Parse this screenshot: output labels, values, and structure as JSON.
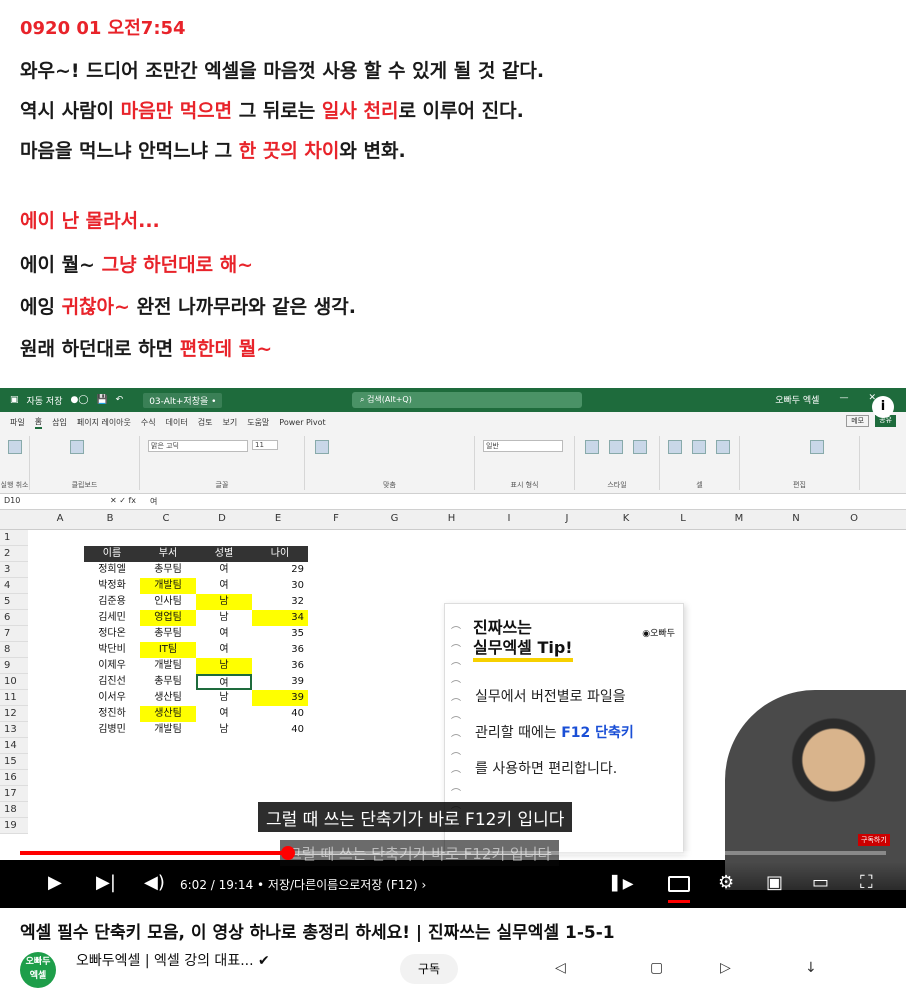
{
  "blog": {
    "timestamp": "0920 01 오전7:54",
    "l1": "와우~! 드디어 조만간 엑셀을 마음껏 사용 할 수 있게 될 것 같다.",
    "l2a": "역시 사람이 ",
    "l2b": "마음만 먹으면",
    "l2c": " 그 뒤로는 ",
    "l2d": "일사 천리",
    "l2e": "로 이루어 진다.",
    "l3a": "마음을 먹느냐 안먹느냐 그 ",
    "l3b": "한 끗의 차이",
    "l3c": "와 변화.",
    "l4": "에이 난 몰라서...",
    "l5a": "에이 뭘~ ",
    "l5b": "그냥 하던대로 해~",
    "l6a": "에잉 ",
    "l6b": "귀찮아~",
    "l6c": " 완전 나까무라와 같은 생각.",
    "l7a": "원래 하던대로 하면 ",
    "l7b": "편한데 뭘~"
  },
  "excel": {
    "autosave": "자동 저장",
    "filename": "03-Alt+저창을 •",
    "search": "검색(Alt+Q)",
    "user": "오빠두 엑셀",
    "menu": [
      "파일",
      "홈",
      "삽입",
      "페이지 레이아웃",
      "수식",
      "데이터",
      "검토",
      "보기",
      "도움말",
      "Power Pivot"
    ],
    "memo": "메모",
    "share": "공유",
    "ribbon_groups": [
      "실행 취소",
      "클립보드",
      "글꼴",
      "맞춤",
      "표시 형식",
      "스타일",
      "셀",
      "편집"
    ],
    "font": "맑은 고딕",
    "fontsize": "11",
    "numfmt": "일반",
    "namebox": "D10",
    "formula": "여",
    "columns": [
      "A",
      "B",
      "C",
      "D",
      "E",
      "F",
      "G",
      "H",
      "I",
      "J",
      "K",
      "L",
      "M",
      "N",
      "O"
    ],
    "headers": [
      "이름",
      "부서",
      "성별",
      "나이"
    ],
    "rows": [
      {
        "n": "정희엘",
        "d": "총무팀",
        "g": "여",
        "a": "29"
      },
      {
        "n": "박정화",
        "d": "개발팀",
        "g": "여",
        "a": "30"
      },
      {
        "n": "김준용",
        "d": "인사팀",
        "g": "남",
        "a": "32"
      },
      {
        "n": "김세민",
        "d": "영업팀",
        "g": "남",
        "a": "34"
      },
      {
        "n": "정다온",
        "d": "총무팀",
        "g": "여",
        "a": "35"
      },
      {
        "n": "박단비",
        "d": "IT팀",
        "g": "여",
        "a": "36"
      },
      {
        "n": "이제우",
        "d": "개발팀",
        "g": "남",
        "a": "36"
      },
      {
        "n": "김진선",
        "d": "총무팀",
        "g": "여",
        "a": "39"
      },
      {
        "n": "이서우",
        "d": "생산팀",
        "g": "남",
        "a": "39"
      },
      {
        "n": "정진하",
        "d": "생산팀",
        "g": "여",
        "a": "40"
      },
      {
        "n": "김병민",
        "d": "개발팀",
        "g": "남",
        "a": "40"
      }
    ],
    "rownums": [
      "1",
      "2",
      "3",
      "4",
      "5",
      "6",
      "7",
      "8",
      "9",
      "10",
      "11",
      "12",
      "13",
      "14",
      "15",
      "16",
      "17",
      "18",
      "19"
    ]
  },
  "tip": {
    "t1": "진짜쓰는",
    "t2": "실무엑셀 Tip!",
    "brand": "오빠두",
    "line1": "실무에서 버전별로 파일을",
    "line2a": "관리할 때에는 ",
    "line2b": "F12 단축키",
    "line3": "를 사용하면 편리합니다."
  },
  "player": {
    "subtitle": "그럴 때 쓰는 단축기가 바로 F12키 입니다",
    "subtitle_prev": "그럴 때 쓰는 단축기가 바로 F12키 입니다",
    "time": "6:02 / 19:14 • 저장/다른이름으로저장 (F12) ›",
    "progress": 0.31,
    "badge": "구독하기",
    "info": "i"
  },
  "video": {
    "title": "엑셀 필수 단축키 모음, 이 영상 하나로 총정리 하세요! | 진짜쓰는 실무엑셀 1-5-1",
    "channel": "오빠두엑셀 | 엑셀 강의 대표... ✔",
    "avatar": "오빠두 엑셀",
    "subscribe": "구독"
  },
  "colors": {
    "accent": "#e8232a",
    "excel": "#1e6b3c",
    "progress": "#ff0000",
    "highlight": "#ffff00"
  }
}
